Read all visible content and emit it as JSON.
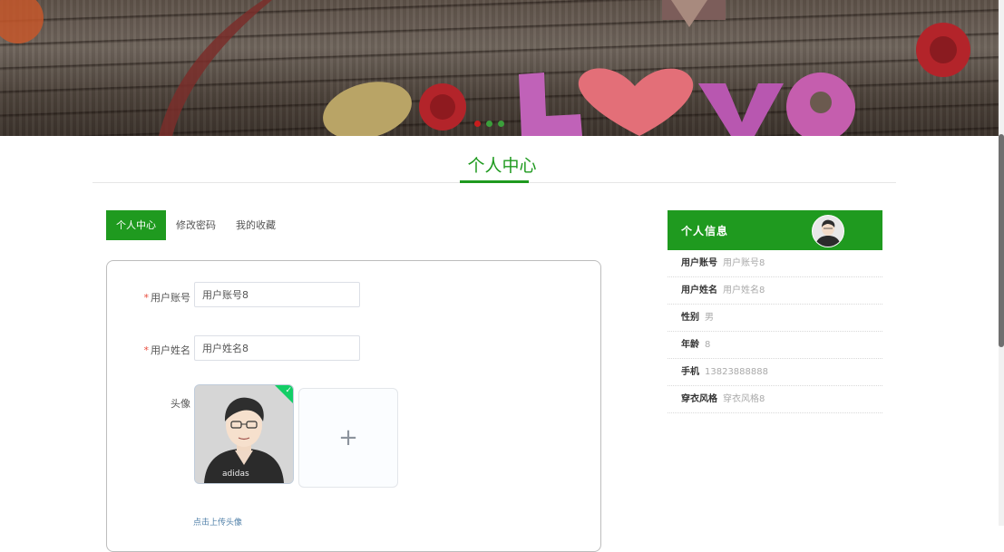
{
  "banner": {
    "image_text": "Love",
    "carousel_dots": 3,
    "active_dot": 0
  },
  "page_title": "个人中心",
  "tabs": [
    {
      "label": "个人中心",
      "active": true
    },
    {
      "label": "修改密码",
      "active": false
    },
    {
      "label": "我的收藏",
      "active": false
    }
  ],
  "form": {
    "account": {
      "required_mark": "*",
      "label": "用户账号",
      "value": "用户账号8"
    },
    "name": {
      "required_mark": "*",
      "label": "用户姓名",
      "value": "用户姓名8"
    },
    "avatar": {
      "label": "头像",
      "upload_icon": "plus-icon",
      "upload_glyph": "+",
      "hint": "点击上传头像"
    }
  },
  "info_panel": {
    "title": "个人信息",
    "rows": [
      {
        "label": "用户账号",
        "value": "用户账号8"
      },
      {
        "label": "用户姓名",
        "value": "用户姓名8"
      },
      {
        "label": "性别",
        "value": "男"
      },
      {
        "label": "年龄",
        "value": "8"
      },
      {
        "label": "手机",
        "value": "13823888888"
      },
      {
        "label": "穿衣风格",
        "value": "穿衣风格8"
      }
    ]
  },
  "colors": {
    "primary": "#1f9a1f",
    "required": "#e84b3c",
    "upload_success": "#13ce66",
    "carousel_active_dot": "#c81d1d"
  }
}
